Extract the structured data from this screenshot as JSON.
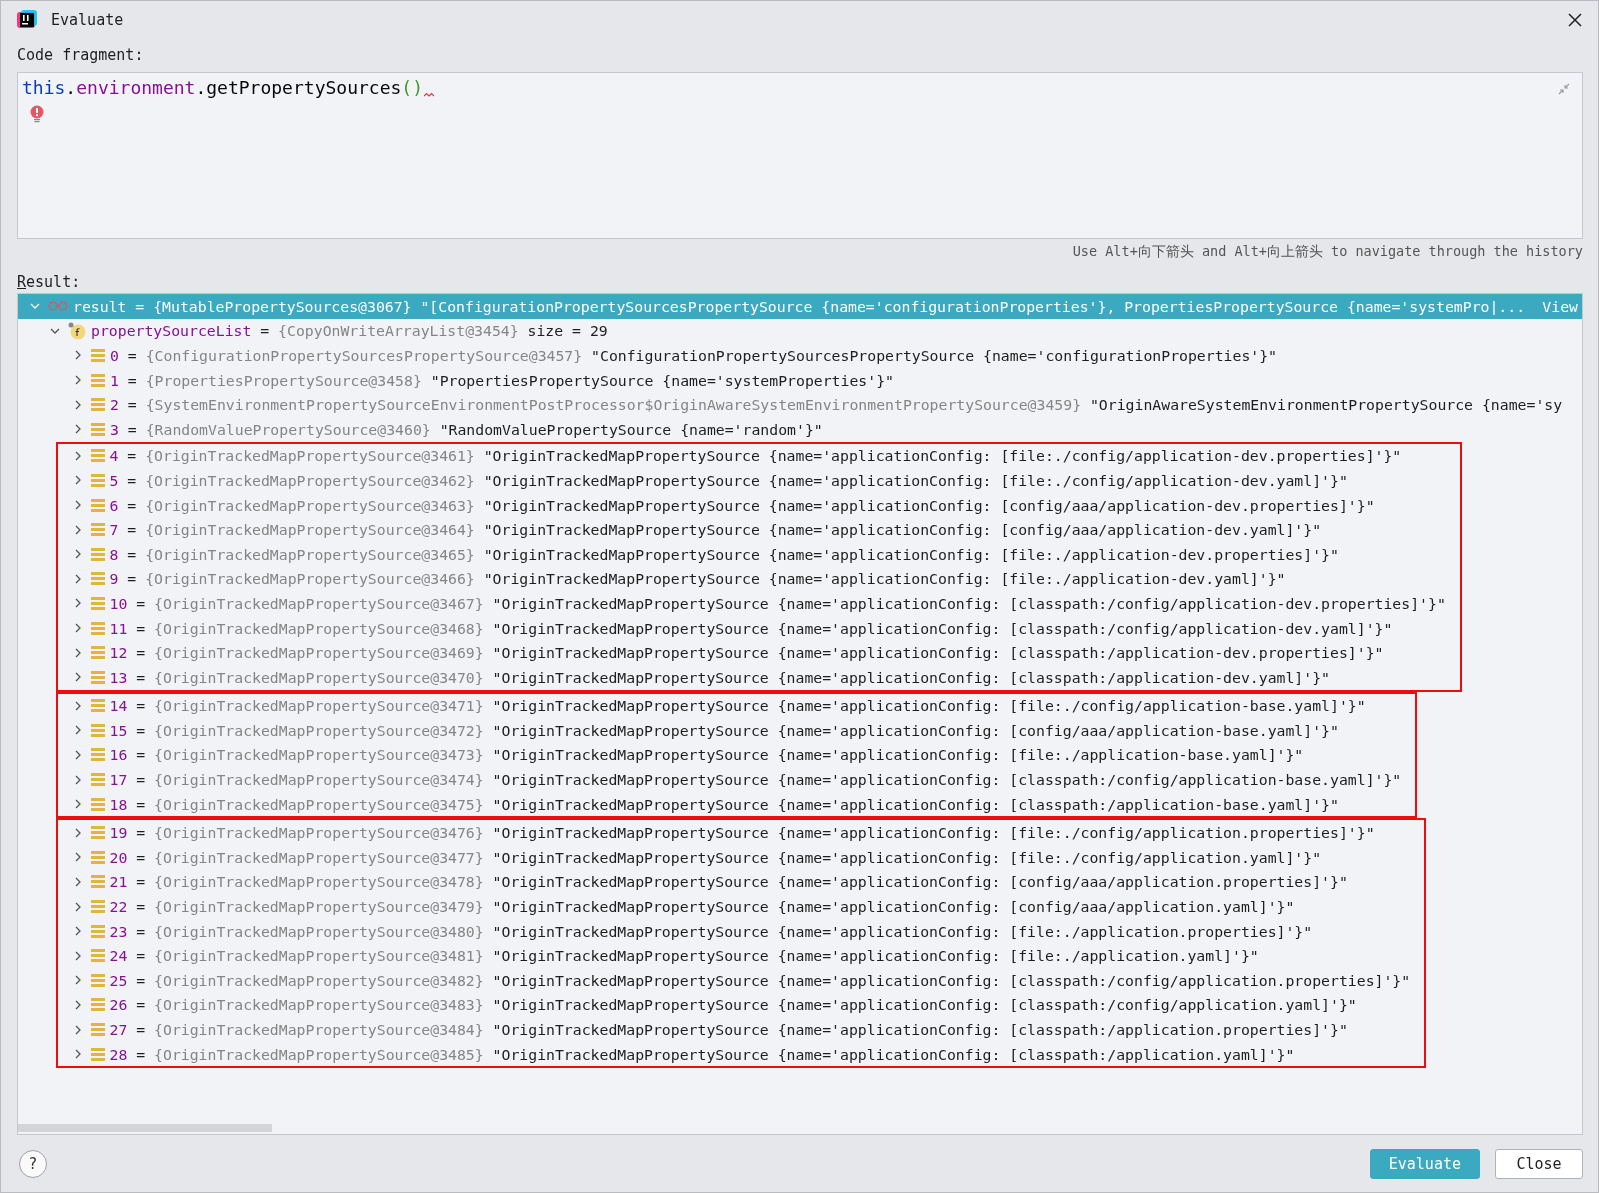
{
  "window": {
    "title": "Evaluate"
  },
  "code_fragment": {
    "label": "Code fragment:",
    "tokens": [
      {
        "kind": "keyword",
        "text": "this"
      },
      {
        "kind": "plain",
        "text": "."
      },
      {
        "kind": "field",
        "text": "environment"
      },
      {
        "kind": "plain",
        "text": ".getPropertySources"
      },
      {
        "kind": "paren",
        "text": "()"
      }
    ],
    "has_error": true
  },
  "history_hint": "Use Alt+向下箭头 and Alt+向上箭头 to navigate through the history",
  "result": {
    "label": "Result:",
    "root": {
      "name": "result",
      "sep": "=",
      "type": "{MutablePropertySources@3067}",
      "value": "\"[ConfigurationPropertySourcesPropertySource {name='configurationProperties'}, PropertiesPropertySource {name='systemPro|...",
      "link": "View",
      "expanded": true,
      "selected": true
    },
    "list": {
      "name": "propertySourceList",
      "sep": "=",
      "type": "{CopyOnWriteArrayList@3454}",
      "extra": "size = 29",
      "expanded": true
    },
    "sections": [
      {
        "boxed": false,
        "rows": [
          {
            "index": "0",
            "type": "{ConfigurationPropertySourcesPropertySource@3457}",
            "value": "\"ConfigurationPropertySourcesPropertySource {name='configurationProperties'}\"",
            "expanded": false
          },
          {
            "index": "1",
            "type": "{PropertiesPropertySource@3458}",
            "value": "\"PropertiesPropertySource {name='systemProperties'}\"",
            "expanded": false
          },
          {
            "index": "2",
            "type": "{SystemEnvironmentPropertySourceEnvironmentPostProcessor$OriginAwareSystemEnvironmentPropertySource@3459}",
            "value": "\"OriginAwareSystemEnvironmentPropertySource {name='sy",
            "expanded": false
          },
          {
            "index": "3",
            "type": "{RandomValuePropertySource@3460}",
            "value": "\"RandomValuePropertySource {name='random'}\"",
            "expanded": false
          }
        ]
      },
      {
        "boxed": true,
        "rows": [
          {
            "index": "4",
            "type": "{OriginTrackedMapPropertySource@3461}",
            "value": "\"OriginTrackedMapPropertySource {name='applicationConfig: [file:./config/application-dev.properties]'}\"",
            "expanded": false
          },
          {
            "index": "5",
            "type": "{OriginTrackedMapPropertySource@3462}",
            "value": "\"OriginTrackedMapPropertySource {name='applicationConfig: [file:./config/application-dev.yaml]'}\"",
            "expanded": false
          },
          {
            "index": "6",
            "type": "{OriginTrackedMapPropertySource@3463}",
            "value": "\"OriginTrackedMapPropertySource {name='applicationConfig: [config/aaa/application-dev.properties]'}\"",
            "expanded": false
          },
          {
            "index": "7",
            "type": "{OriginTrackedMapPropertySource@3464}",
            "value": "\"OriginTrackedMapPropertySource {name='applicationConfig: [config/aaa/application-dev.yaml]'}\"",
            "expanded": false
          },
          {
            "index": "8",
            "type": "{OriginTrackedMapPropertySource@3465}",
            "value": "\"OriginTrackedMapPropertySource {name='applicationConfig: [file:./application-dev.properties]'}\"",
            "expanded": false
          },
          {
            "index": "9",
            "type": "{OriginTrackedMapPropertySource@3466}",
            "value": "\"OriginTrackedMapPropertySource {name='applicationConfig: [file:./application-dev.yaml]'}\"",
            "expanded": false
          },
          {
            "index": "10",
            "type": "{OriginTrackedMapPropertySource@3467}",
            "value": "\"OriginTrackedMapPropertySource {name='applicationConfig: [classpath:/config/application-dev.properties]'}\"",
            "expanded": false
          },
          {
            "index": "11",
            "type": "{OriginTrackedMapPropertySource@3468}",
            "value": "\"OriginTrackedMapPropertySource {name='applicationConfig: [classpath:/config/application-dev.yaml]'}\"",
            "expanded": false
          },
          {
            "index": "12",
            "type": "{OriginTrackedMapPropertySource@3469}",
            "value": "\"OriginTrackedMapPropertySource {name='applicationConfig: [classpath:/application-dev.properties]'}\"",
            "expanded": false
          },
          {
            "index": "13",
            "type": "{OriginTrackedMapPropertySource@3470}",
            "value": "\"OriginTrackedMapPropertySource {name='applicationConfig: [classpath:/application-dev.yaml]'}\"",
            "expanded": false
          }
        ]
      },
      {
        "boxed": true,
        "rows": [
          {
            "index": "14",
            "type": "{OriginTrackedMapPropertySource@3471}",
            "value": "\"OriginTrackedMapPropertySource {name='applicationConfig: [file:./config/application-base.yaml]'}\"",
            "expanded": false
          },
          {
            "index": "15",
            "type": "{OriginTrackedMapPropertySource@3472}",
            "value": "\"OriginTrackedMapPropertySource {name='applicationConfig: [config/aaa/application-base.yaml]'}\"",
            "expanded": false
          },
          {
            "index": "16",
            "type": "{OriginTrackedMapPropertySource@3473}",
            "value": "\"OriginTrackedMapPropertySource {name='applicationConfig: [file:./application-base.yaml]'}\"",
            "expanded": false
          },
          {
            "index": "17",
            "type": "{OriginTrackedMapPropertySource@3474}",
            "value": "\"OriginTrackedMapPropertySource {name='applicationConfig: [classpath:/config/application-base.yaml]'}\"",
            "expanded": false
          },
          {
            "index": "18",
            "type": "{OriginTrackedMapPropertySource@3475}",
            "value": "\"OriginTrackedMapPropertySource {name='applicationConfig: [classpath:/application-base.yaml]'}\"",
            "expanded": false
          }
        ]
      },
      {
        "boxed": true,
        "rows": [
          {
            "index": "19",
            "type": "{OriginTrackedMapPropertySource@3476}",
            "value": "\"OriginTrackedMapPropertySource {name='applicationConfig: [file:./config/application.properties]'}\"",
            "expanded": false
          },
          {
            "index": "20",
            "type": "{OriginTrackedMapPropertySource@3477}",
            "value": "\"OriginTrackedMapPropertySource {name='applicationConfig: [file:./config/application.yaml]'}\"",
            "expanded": false
          },
          {
            "index": "21",
            "type": "{OriginTrackedMapPropertySource@3478}",
            "value": "\"OriginTrackedMapPropertySource {name='applicationConfig: [config/aaa/application.properties]'}\"",
            "expanded": false
          },
          {
            "index": "22",
            "type": "{OriginTrackedMapPropertySource@3479}",
            "value": "\"OriginTrackedMapPropertySource {name='applicationConfig: [config/aaa/application.yaml]'}\"",
            "expanded": false
          },
          {
            "index": "23",
            "type": "{OriginTrackedMapPropertySource@3480}",
            "value": "\"OriginTrackedMapPropertySource {name='applicationConfig: [file:./application.properties]'}\"",
            "expanded": false
          },
          {
            "index": "24",
            "type": "{OriginTrackedMapPropertySource@3481}",
            "value": "\"OriginTrackedMapPropertySource {name='applicationConfig: [file:./application.yaml]'}\"",
            "expanded": false
          },
          {
            "index": "25",
            "type": "{OriginTrackedMapPropertySource@3482}",
            "value": "\"OriginTrackedMapPropertySource {name='applicationConfig: [classpath:/config/application.properties]'}\"",
            "expanded": false
          },
          {
            "index": "26",
            "type": "{OriginTrackedMapPropertySource@3483}",
            "value": "\"OriginTrackedMapPropertySource {name='applicationConfig: [classpath:/config/application.yaml]'}\"",
            "expanded": false
          },
          {
            "index": "27",
            "type": "{OriginTrackedMapPropertySource@3484}",
            "value": "\"OriginTrackedMapPropertySource {name='applicationConfig: [classpath:/application.properties]'}\"",
            "expanded": false
          },
          {
            "index": "28",
            "type": "{OriginTrackedMapPropertySource@3485}",
            "value": "\"OriginTrackedMapPropertySource {name='applicationConfig: [classpath:/application.yaml]'}\"",
            "expanded": false
          }
        ]
      }
    ]
  },
  "help_button": "?",
  "buttons": [
    {
      "label": "Evaluate",
      "primary": true
    },
    {
      "label": "Close",
      "primary": false
    }
  ]
}
